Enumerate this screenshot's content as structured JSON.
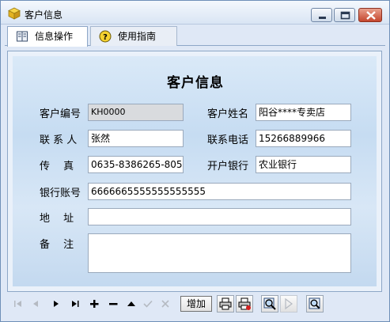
{
  "window": {
    "title": "客户信息",
    "icon": "box-icon"
  },
  "tabs": [
    {
      "label": "信息操作",
      "icon": "book-icon",
      "active": true
    },
    {
      "label": "使用指南",
      "icon": "help-icon",
      "active": false
    }
  ],
  "form": {
    "title": "客户信息",
    "labels": {
      "customer_id": "客户编号",
      "customer_name": "客户姓名",
      "contact": "联 系 人",
      "phone": "联系电话",
      "fax": "传　 真",
      "bank": "开户银行",
      "account": "银行账号",
      "address": "地　 址",
      "remark": "备　 注"
    },
    "values": {
      "customer_id": "KH0000",
      "customer_name": "阳谷****专卖店",
      "contact": "张然",
      "phone": "15266889966",
      "fax": "0635-8386265-805",
      "bank": "农业银行",
      "account": "6666665555555555555",
      "address": "",
      "remark": ""
    }
  },
  "toolbar": {
    "first_icon": "first-record-icon",
    "prev_icon": "prev-record-icon",
    "next_icon": "next-record-icon",
    "last_icon": "last-record-icon",
    "insert_icon": "plus-icon",
    "delete_icon": "minus-icon",
    "edit_icon": "up-triangle-icon",
    "post_icon": "check-icon",
    "cancel_icon": "x-icon",
    "add_label": "增加",
    "print_icon": "printer-icon",
    "print_preview_icon": "printer-delete-icon",
    "query_icon": "magnifier-icon",
    "play_icon": "play-icon",
    "search_icon": "zoom-icon"
  },
  "colors": {
    "panel_bg": "#c6dcf2",
    "close_button": "#c4462e",
    "readonly_field": "#d9dbde"
  }
}
